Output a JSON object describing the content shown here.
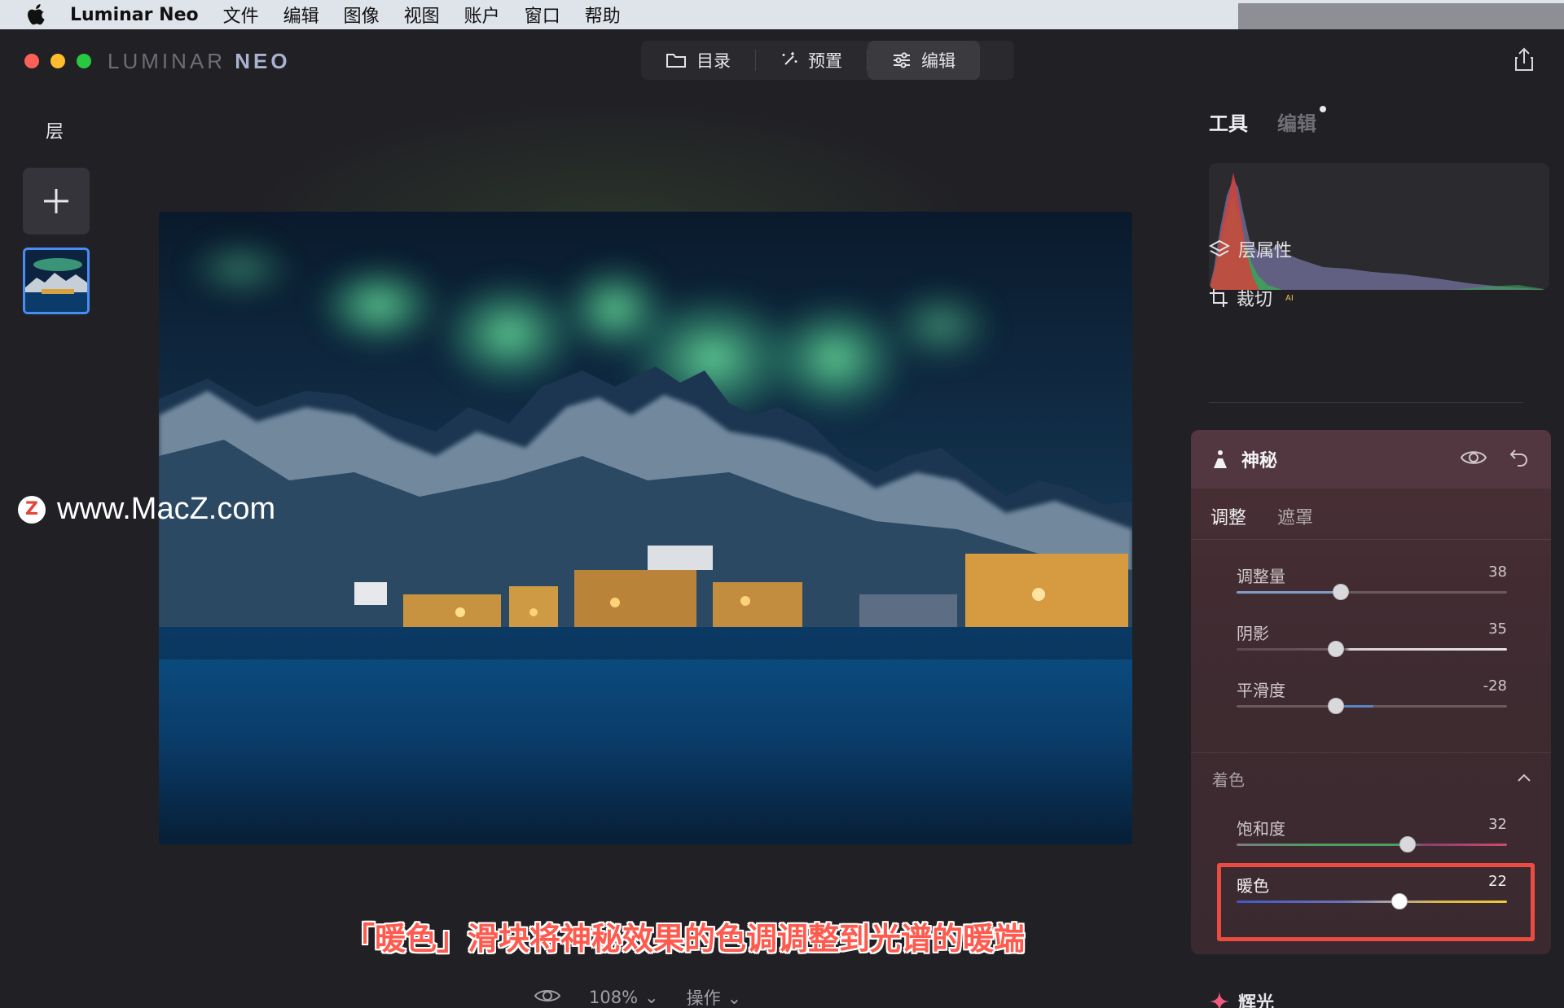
{
  "menubar": {
    "app_name": "Luminar Neo",
    "items": [
      "文件",
      "编辑",
      "图像",
      "视图",
      "账户",
      "窗口",
      "帮助"
    ]
  },
  "window": {
    "logo_part1": "LUMINAR ",
    "logo_part2": "NEO",
    "modes": {
      "catalog": "目录",
      "presets": "预置",
      "edit": "编辑"
    },
    "active_mode": "edit"
  },
  "left_panel": {
    "title": "层"
  },
  "canvas": {
    "watermark": "www.MacZ.com",
    "caption": "「暖色」滑块将神秘效果的色调调整到光谱的暖端",
    "zoom": "108%",
    "actions_label": "操作"
  },
  "right_panel": {
    "tab_tools": "工具",
    "tab_edits": "编辑",
    "layer_props": "层属性",
    "crop": "裁切",
    "crop_badge": "AI",
    "tool": {
      "name": "神秘",
      "subtab_adjust": "调整",
      "subtab_mask": "遮罩",
      "sliders": [
        {
          "label": "调整量",
          "value": "38",
          "level": 38,
          "fill_color": "#7f9dc8"
        },
        {
          "label": "阴影",
          "value": "35",
          "level": 35,
          "fill_color": "#6a5a60"
        },
        {
          "label": "平滑度",
          "value": "-28",
          "level": -28,
          "fill_color": "#5d84c0"
        }
      ],
      "color_section": "着色",
      "color_sliders": [
        {
          "label": "饱和度",
          "value": "32",
          "level": 32
        },
        {
          "label": "暖色",
          "value": "22",
          "level": 22
        }
      ]
    },
    "next_tool": "辉光"
  },
  "colors": {
    "accent_blue": "#4a8cf2",
    "highlight_red": "#ec4b42",
    "caption_red": "#ff5a4e",
    "panel_maroon": "#4a3036"
  }
}
